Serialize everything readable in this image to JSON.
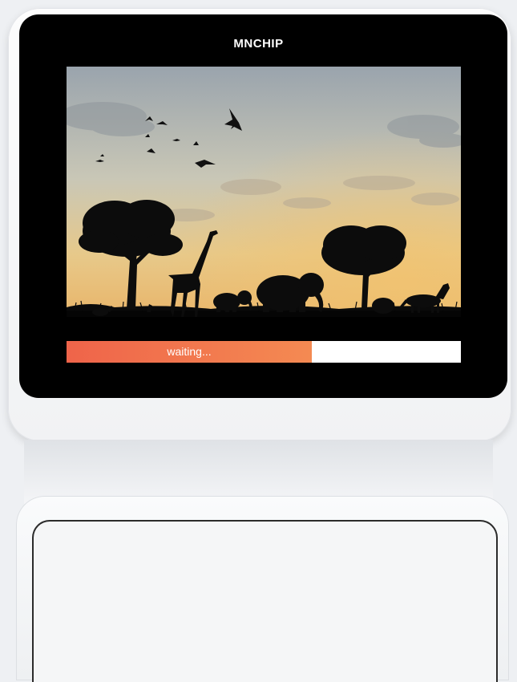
{
  "device": {
    "brand": "MNCHIP"
  },
  "screen": {
    "scene_image": "african-savanna-sunset-silhouette",
    "progress": {
      "label": "waiting...",
      "fraction": 0.622,
      "fill_color": "#f07050"
    }
  }
}
